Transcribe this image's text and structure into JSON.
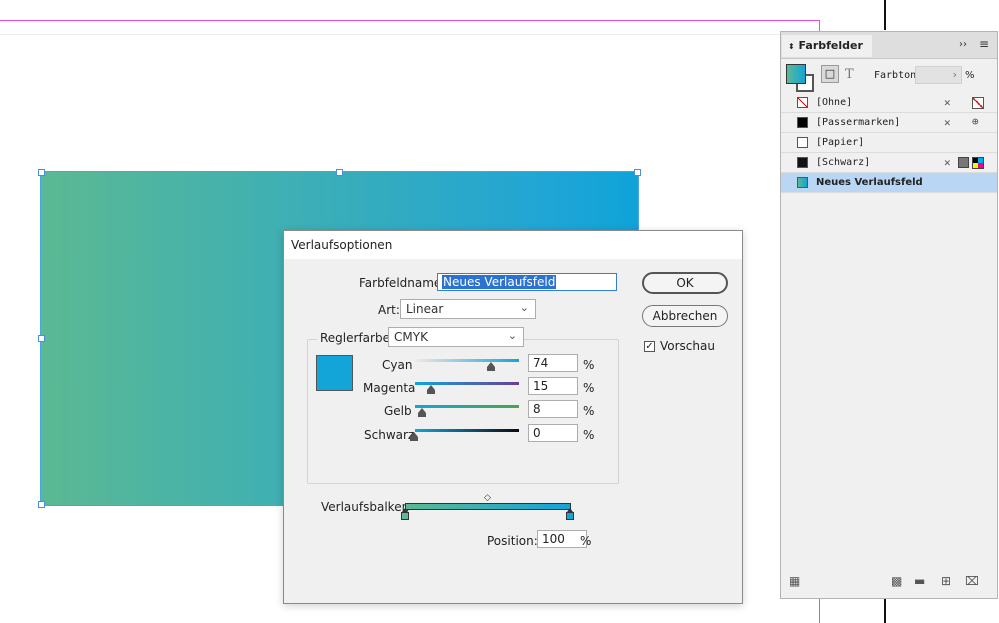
{
  "dialog": {
    "title": "Verlaufsoptionen",
    "name_label": "Farbfeldname:",
    "name_value": "Neues Verlaufsfeld",
    "type_label": "Art:",
    "type_value": "Linear",
    "stop_color_label": "Reglerfarbe:",
    "stop_color_value": "CMYK",
    "ok_label": "OK",
    "cancel_label": "Abbrechen",
    "preview_label": "Vorschau",
    "preview_checked": true,
    "channels": [
      {
        "label": "Cyan",
        "value": "74",
        "unit": "%"
      },
      {
        "label": "Magenta",
        "value": "15",
        "unit": "%"
      },
      {
        "label": "Gelb",
        "value": "8",
        "unit": "%"
      },
      {
        "label": "Schwarz",
        "value": "0",
        "unit": "%"
      }
    ],
    "ramp_label": "Verlaufsbalken",
    "position_label": "Position:",
    "position_value": "100",
    "position_unit": "%",
    "stop_color_hex": "#13a4d8"
  },
  "panel": {
    "title": "Farbfelder",
    "tint_label": "Farbton:",
    "tint_unit": "%",
    "swatches": [
      {
        "name": "[Ohne]",
        "color": "none"
      },
      {
        "name": "[Passermarken]",
        "color": "#000000"
      },
      {
        "name": "[Papier]",
        "color": "#ffffff"
      },
      {
        "name": "[Schwarz]",
        "color": "#111111"
      },
      {
        "name": "Neues Verlaufsfeld",
        "color": "gradient",
        "selected": true
      }
    ]
  },
  "colors": {
    "gradient_start": "#5bb993",
    "gradient_end": "#13a4d8",
    "selection": "#b9d6f5"
  }
}
